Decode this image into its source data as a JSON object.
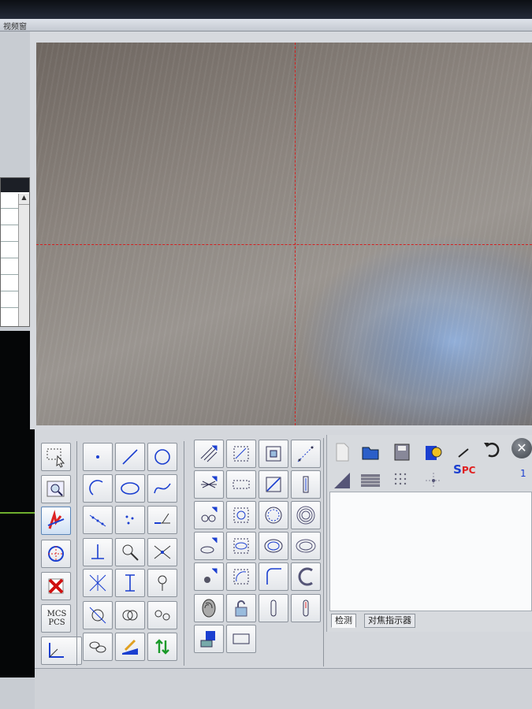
{
  "window": {
    "title": "视频窗"
  },
  "tabs": [
    {
      "label": "检测"
    },
    {
      "label": "对焦指示器"
    }
  ],
  "right_toolbar": {
    "spc_label": "S",
    "spc_label_red": "PC",
    "page_number": "1"
  },
  "left_tools": {
    "mcs_label": "MCS",
    "pcs_label": "PCS"
  },
  "icons": {
    "select": "select-arrow-icon",
    "zoom": "zoom-window-icon",
    "align": "align-icon",
    "construct": "construct-icon",
    "delete": "delete-icon",
    "axis": "axis-icon",
    "point": "point-icon",
    "line": "line-icon",
    "circle": "circle-icon",
    "arc": "arc-icon",
    "ellipse": "ellipse-icon",
    "curve": "curve-icon",
    "close": "close-icon",
    "undo": "undo-icon"
  },
  "colors": {
    "crosshair": "#d42020",
    "accent": "#1b3fd0",
    "toolbar_bg": "#d4d7dc"
  }
}
